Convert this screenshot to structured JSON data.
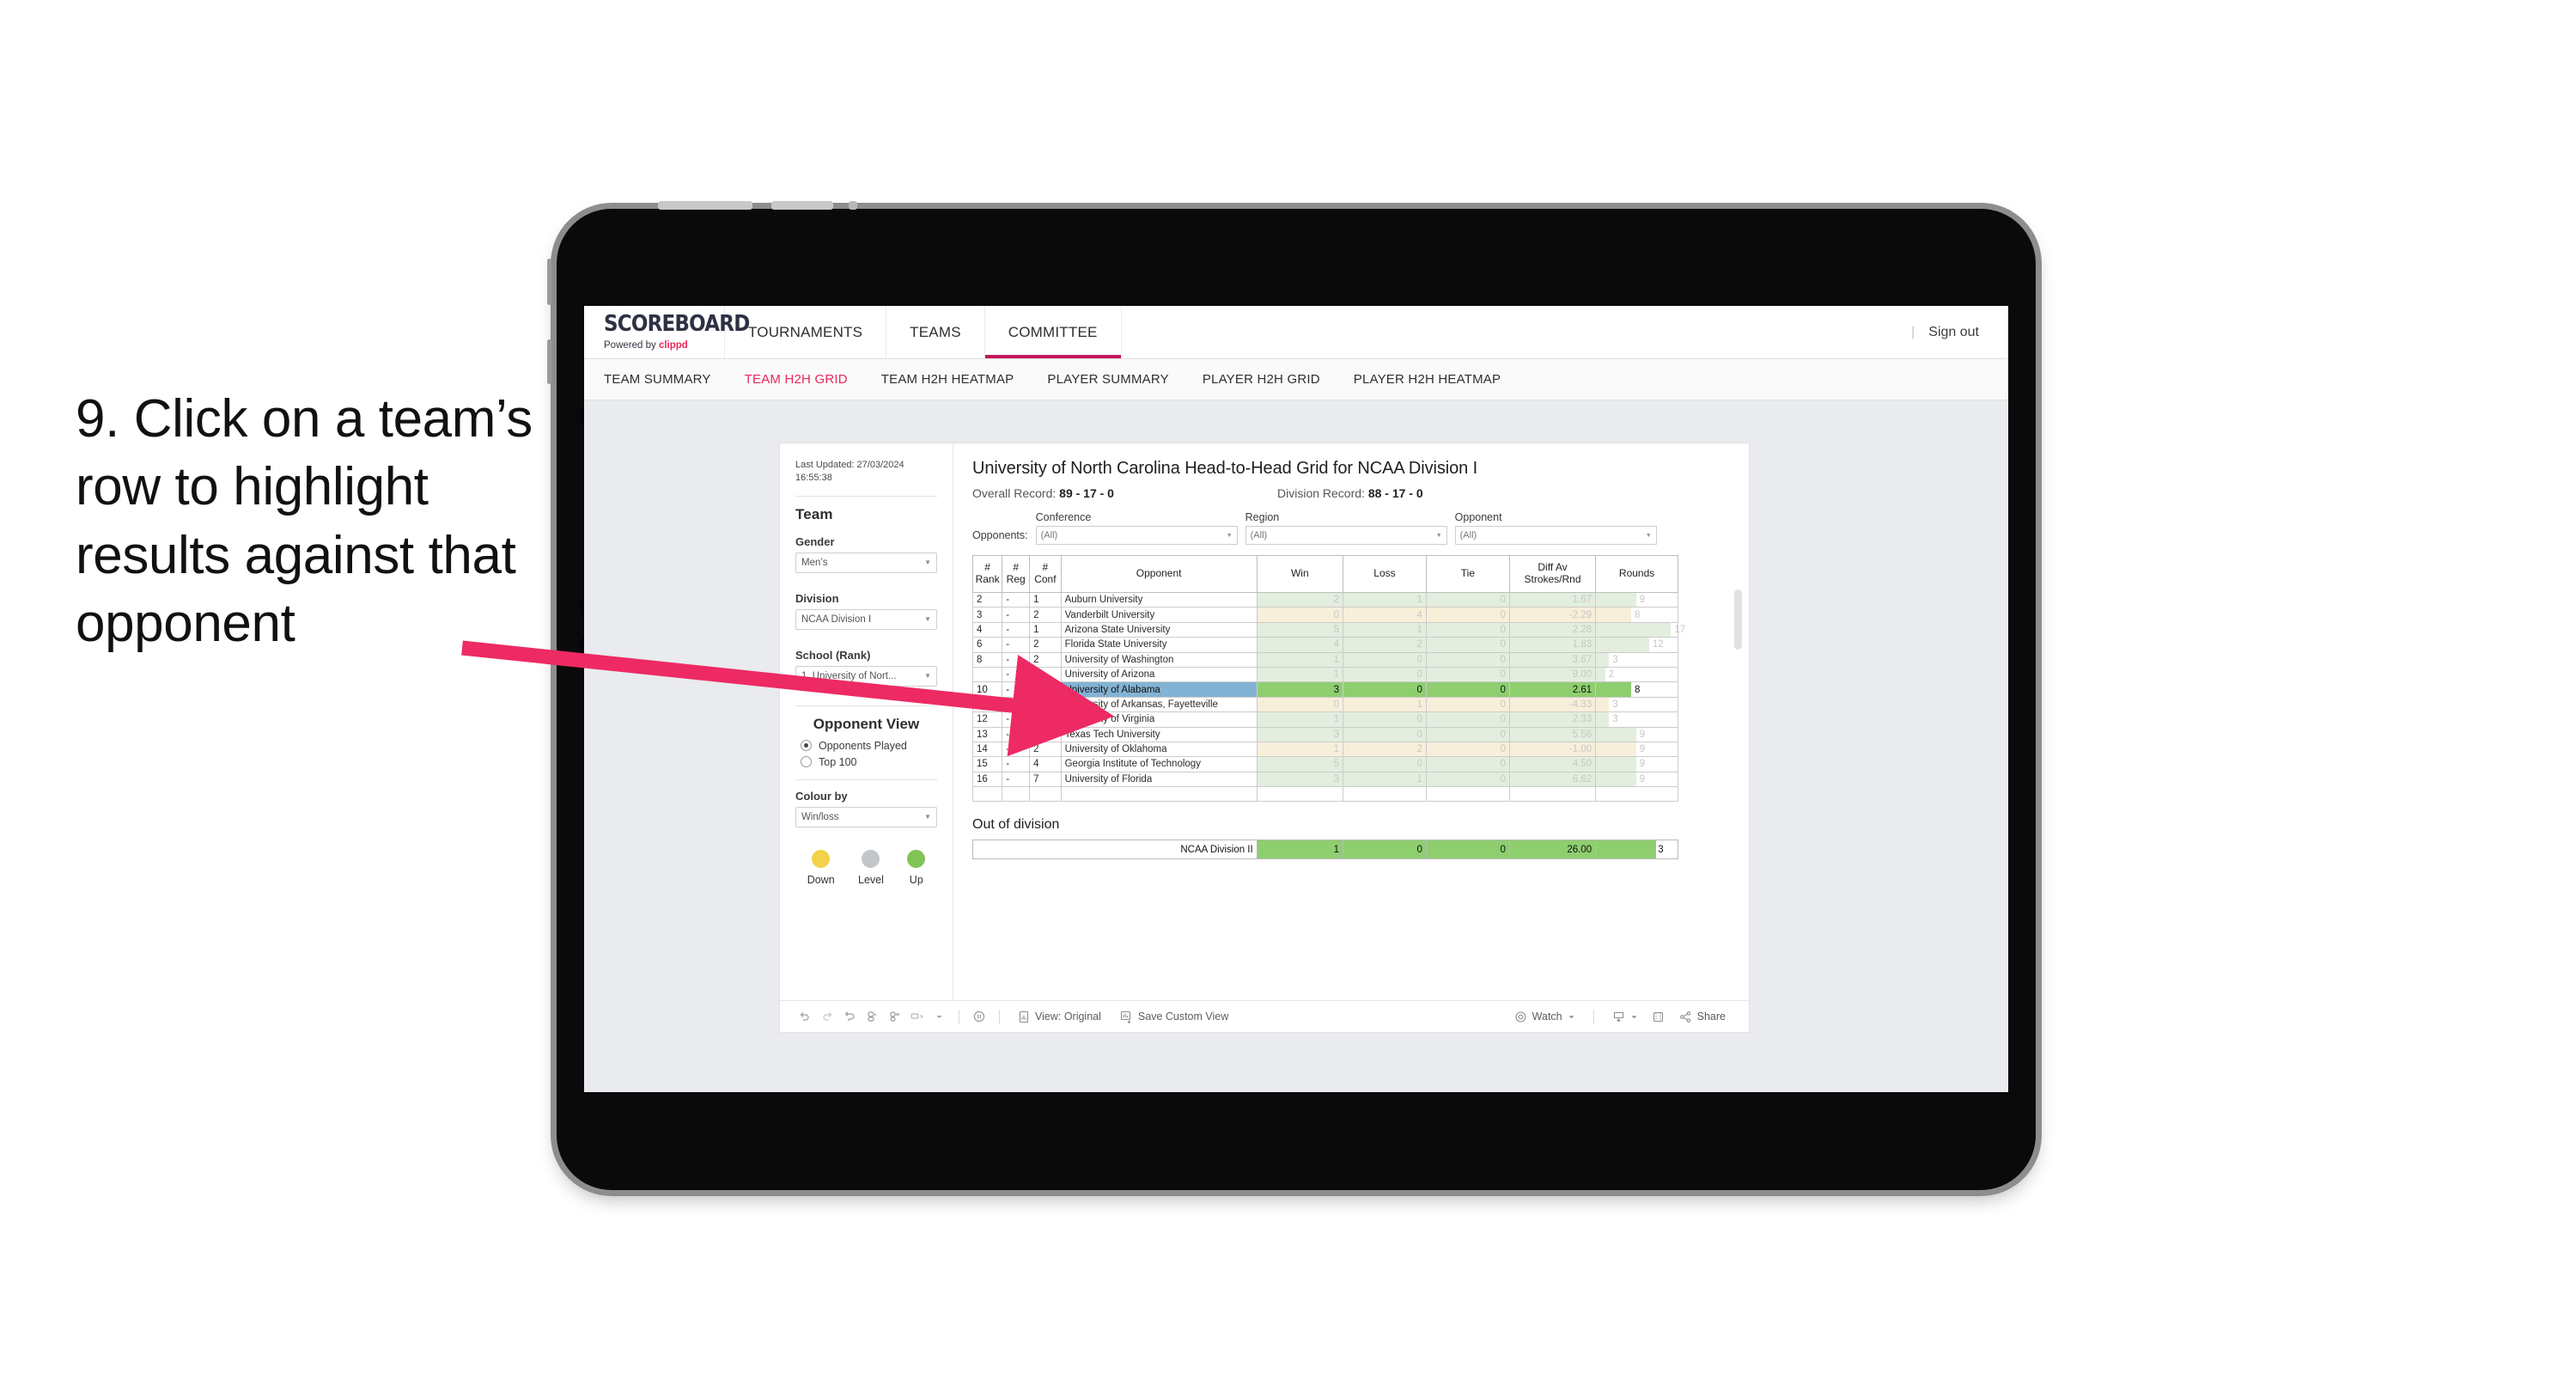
{
  "annotation": {
    "text": "9. Click on a team’s row to highlight results against that opponent",
    "arrow_color": "#ED2A63"
  },
  "app": {
    "brand": {
      "name": "SCOREBOARD",
      "powered_prefix": "Powered by ",
      "powered_brand": "clippd"
    },
    "nav": [
      {
        "label": "TOURNAMENTS",
        "active": false
      },
      {
        "label": "TEAMS",
        "active": false
      },
      {
        "label": "COMMITTEE",
        "active": true
      }
    ],
    "sign_out": "Sign out",
    "subtabs": [
      {
        "label": "TEAM SUMMARY",
        "active": false
      },
      {
        "label": "TEAM H2H GRID",
        "active": true
      },
      {
        "label": "TEAM H2H HEATMAP",
        "active": false
      },
      {
        "label": "PLAYER SUMMARY",
        "active": false
      },
      {
        "label": "PLAYER H2H GRID",
        "active": false
      },
      {
        "label": "PLAYER H2H HEATMAP",
        "active": false
      }
    ]
  },
  "sidebar": {
    "last_updated": "Last Updated: 27/03/2024 16:55:38",
    "team_title": "Team",
    "gender": {
      "label": "Gender",
      "value": "Men’s"
    },
    "division": {
      "label": "Division",
      "value": "NCAA Division I"
    },
    "school": {
      "label": "School (Rank)",
      "value": "1. University of Nort..."
    },
    "opponent_view": {
      "title": "Opponent View",
      "options": [
        {
          "label": "Opponents Played",
          "selected": true
        },
        {
          "label": "Top 100",
          "selected": false
        }
      ]
    },
    "colour_by": {
      "label": "Colour by",
      "value": "Win/loss"
    },
    "legend": [
      {
        "label": "Down",
        "color": "#F2D24B"
      },
      {
        "label": "Level",
        "color": "#C3C6C8"
      },
      {
        "label": "Up",
        "color": "#7FC455"
      }
    ]
  },
  "main": {
    "title": "University of North Carolina Head-to-Head Grid for NCAA Division I",
    "overall_record_label": "Overall Record:",
    "overall_record_value": "89 - 17 - 0",
    "division_record_label": "Division Record:",
    "division_record_value": "88 - 17 - 0",
    "opponents_label": "Opponents:",
    "filters": [
      {
        "caption": "Conference",
        "value": "(All)"
      },
      {
        "caption": "Region",
        "value": "(All)"
      },
      {
        "caption": "Opponent",
        "value": "(All)"
      }
    ]
  },
  "chart_data": {
    "type": "table",
    "title": "University of North Carolina Head-to-Head Grid for NCAA Division I",
    "columns": [
      "# Rank",
      "# Reg",
      "# Conf",
      "Opponent",
      "Win",
      "Loss",
      "Tie",
      "Diff Av Strokes/Rnd",
      "Rounds"
    ],
    "rounds_max": 17,
    "rows": [
      {
        "rank": "2",
        "reg": "-",
        "conf": "1",
        "opponent": "Auburn University",
        "win": "2",
        "loss": "1",
        "tie": "0",
        "diff": "1.67",
        "rounds": 9,
        "result": "up",
        "selected": false
      },
      {
        "rank": "3",
        "reg": "-",
        "conf": "2",
        "opponent": "Vanderbilt University",
        "win": "0",
        "loss": "4",
        "tie": "0",
        "diff": "-2.29",
        "rounds": 8,
        "result": "down",
        "selected": false
      },
      {
        "rank": "4",
        "reg": "-",
        "conf": "1",
        "opponent": "Arizona State University",
        "win": "5",
        "loss": "1",
        "tie": "0",
        "diff": "2.28",
        "rounds": 17,
        "result": "up",
        "selected": false
      },
      {
        "rank": "6",
        "reg": "-",
        "conf": "2",
        "opponent": "Florida State University",
        "win": "4",
        "loss": "2",
        "tie": "0",
        "diff": "1.83",
        "rounds": 12,
        "result": "up",
        "selected": false
      },
      {
        "rank": "8",
        "reg": "-",
        "conf": "2",
        "opponent": "University of Washington",
        "win": "1",
        "loss": "0",
        "tie": "0",
        "diff": "3.67",
        "rounds": 3,
        "result": "up",
        "selected": false
      },
      {
        "rank": "",
        "reg": "-",
        "conf": "3",
        "opponent": "University of Arizona",
        "win": "1",
        "loss": "0",
        "tie": "0",
        "diff": "9.00",
        "rounds": 2,
        "result": "up",
        "selected": false
      },
      {
        "rank": "10",
        "reg": "-",
        "conf": "5",
        "opponent": "University of Alabama",
        "win": "3",
        "loss": "0",
        "tie": "0",
        "diff": "2.61",
        "rounds": 8,
        "result": "up",
        "selected": true
      },
      {
        "rank": "11",
        "reg": "-",
        "conf": "6",
        "opponent": "University of Arkansas, Fayetteville",
        "win": "0",
        "loss": "1",
        "tie": "0",
        "diff": "-4.33",
        "rounds": 3,
        "result": "down",
        "selected": false
      },
      {
        "rank": "12",
        "reg": "-",
        "conf": "3",
        "opponent": "University of Virginia",
        "win": "1",
        "loss": "0",
        "tie": "0",
        "diff": "2.33",
        "rounds": 3,
        "result": "up",
        "selected": false
      },
      {
        "rank": "13",
        "reg": "-",
        "conf": "1",
        "opponent": "Texas Tech University",
        "win": "3",
        "loss": "0",
        "tie": "0",
        "diff": "5.56",
        "rounds": 9,
        "result": "up",
        "selected": false
      },
      {
        "rank": "14",
        "reg": "-",
        "conf": "2",
        "opponent": "University of Oklahoma",
        "win": "1",
        "loss": "2",
        "tie": "0",
        "diff": "-1.00",
        "rounds": 9,
        "result": "down",
        "selected": false
      },
      {
        "rank": "15",
        "reg": "-",
        "conf": "4",
        "opponent": "Georgia Institute of Technology",
        "win": "5",
        "loss": "0",
        "tie": "0",
        "diff": "4.50",
        "rounds": 9,
        "result": "up",
        "selected": false
      },
      {
        "rank": "16",
        "reg": "-",
        "conf": "7",
        "opponent": "University of Florida",
        "win": "3",
        "loss": "1",
        "tie": "0",
        "diff": "6.62",
        "rounds": 9,
        "result": "up",
        "selected": false
      }
    ]
  },
  "out_of_division": {
    "title": "Out of division",
    "row": {
      "label": "NCAA Division II",
      "win": "1",
      "loss": "0",
      "tie": "0",
      "diff": "26.00",
      "rounds": "3"
    }
  },
  "toolbar": {
    "view_label": "View: Original",
    "save_label": "Save Custom View",
    "watch_label": "Watch",
    "share_label": "Share"
  }
}
